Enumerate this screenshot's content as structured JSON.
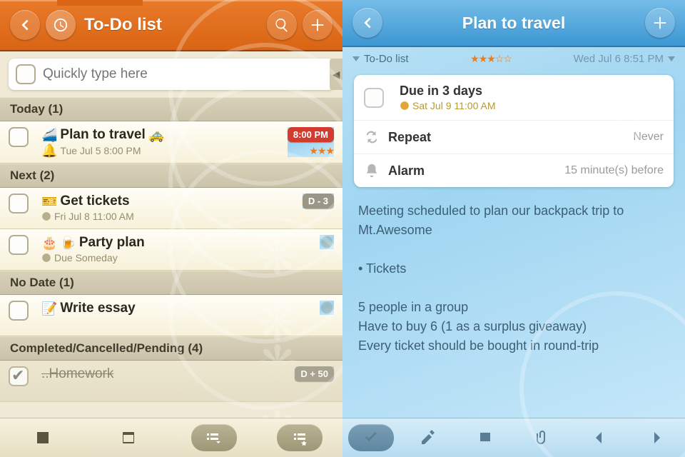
{
  "left": {
    "title": "To-Do list",
    "quick_placeholder": "Quickly type here",
    "sections": {
      "today": {
        "label": "Today (1)"
      },
      "next": {
        "label": "Next (2)"
      },
      "nodate": {
        "label": "No Date (1)"
      },
      "done": {
        "label": "Completed/Cancelled/Pending (4)"
      }
    },
    "items": {
      "travel": {
        "title": "Plan to travel",
        "sub": "Tue Jul 5 8:00 PM",
        "badge": "8:00 PM",
        "stars": "★★★"
      },
      "tickets": {
        "title": "Get tickets",
        "sub": "Fri Jul 8  11:00 AM",
        "badge": "D - 3"
      },
      "party": {
        "title": "Party plan",
        "sub": "Due Someday"
      },
      "essay": {
        "title": "Write essay"
      },
      "homework": {
        "title": "..Homework",
        "badge": "D + 50"
      }
    }
  },
  "right": {
    "title": "Plan to travel",
    "meta": {
      "list": "To-Do list",
      "stars": "★★★☆☆",
      "datetime": "Wed Jul 6 8:51 PM"
    },
    "card": {
      "due_title": "Due in 3 days",
      "due_sub": "Sat Jul 9 11:00 AM",
      "repeat_label": "Repeat",
      "repeat_value": "Never",
      "alarm_label": "Alarm",
      "alarm_value": "15 minute(s) before"
    },
    "notes": "Meeting scheduled to plan our backpack trip to Mt.Awesome\n\n• Tickets\n\n5 people in a group\nHave to buy 6 (1 as a surplus giveaway)\nEvery ticket should be bought in round-trip"
  },
  "colors": {
    "orange": "#d96514",
    "blue": "#3c97d3"
  }
}
